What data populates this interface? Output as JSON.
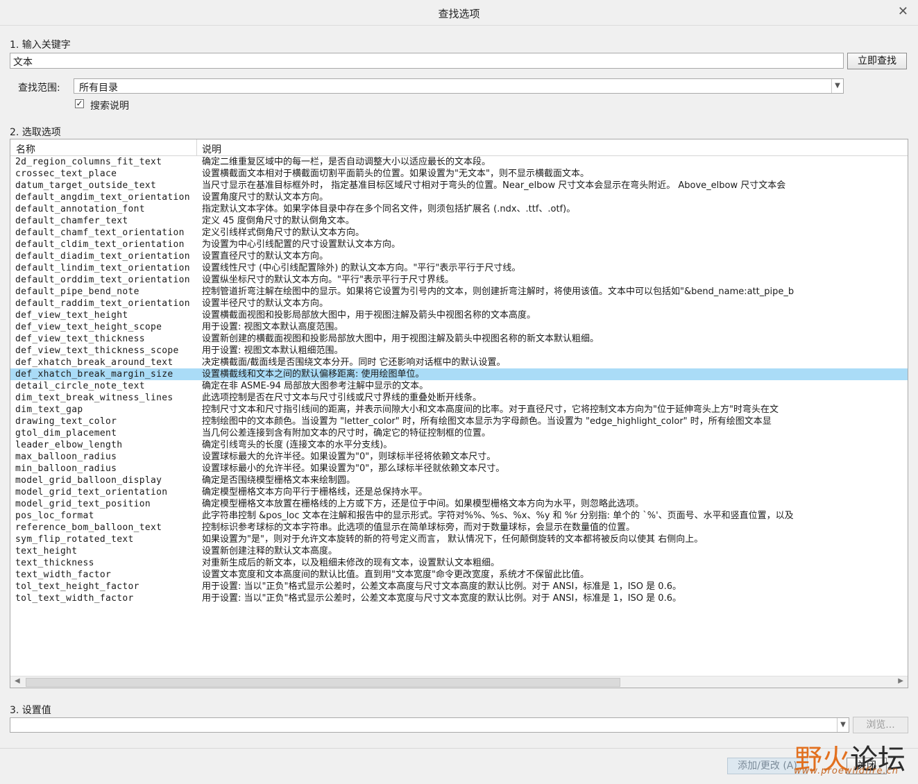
{
  "dialog": {
    "title": "查找选项"
  },
  "step1": {
    "label": "1.  输入关键字",
    "keyword_value": "文本",
    "search_button": "立即查找"
  },
  "scope": {
    "label": "查找范围:",
    "value": "所有目录"
  },
  "search_desc": {
    "label": "搜索说明",
    "checked": true
  },
  "step2": {
    "label": "2.  选取选项"
  },
  "table": {
    "columns": [
      "名称",
      "说明"
    ],
    "selected_index": 18,
    "rows": [
      {
        "name": "2d_region_columns_fit_text",
        "desc": "确定二维重复区域中的每一栏，是否自动调整大小以适应最长的文本段。"
      },
      {
        "name": "crossec_text_place",
        "desc": "设置横截面文本相对于横截面切割平面箭头的位置。如果设置为\"无文本\"，则不显示横截面文本。"
      },
      {
        "name": "datum_target_outside_text",
        "desc": "当尺寸显示在基准目标框外时， 指定基准目标区域尺寸相对于弯头的位置。Near_elbow 尺寸文本会显示在弯头附近。 Above_elbow 尺寸文本会"
      },
      {
        "name": "default_angdim_text_orientation",
        "desc": "设置角度尺寸的默认文本方向。"
      },
      {
        "name": "default_annotation_font",
        "desc": "指定默认文本字体。如果字体目录中存在多个同名文件，则须包括扩展名 (.ndx、.ttf、.otf)。"
      },
      {
        "name": "default_chamfer_text",
        "desc": "定义 45 度倒角尺寸的默认倒角文本。"
      },
      {
        "name": "default_chamf_text_orientation",
        "desc": "定义引线样式倒角尺寸的默认文本方向。"
      },
      {
        "name": "default_cldim_text_orientation",
        "desc": "为设置为中心引线配置的尺寸设置默认文本方向。"
      },
      {
        "name": "default_diadim_text_orientation",
        "desc": "设置直径尺寸的默认文本方向。"
      },
      {
        "name": "default_lindim_text_orientation",
        "desc": "设置线性尺寸 (中心引线配置除外) 的默认文本方向。\"平行\"表示平行于尺寸线。"
      },
      {
        "name": "default_orddim_text_orientation",
        "desc": "设置纵坐标尺寸的默认文本方向。\"平行\"表示平行于尺寸界线。"
      },
      {
        "name": "default_pipe_bend_note",
        "desc": "控制管道折弯注解在绘图中的显示。如果将它设置为引号内的文本，则创建折弯注解时，将使用该值。文本中可以包括如\"&bend_name:att_pipe_b"
      },
      {
        "name": "default_raddim_text_orientation",
        "desc": "设置半径尺寸的默认文本方向。"
      },
      {
        "name": "def_view_text_height",
        "desc": "设置横截面视图和投影局部放大图中，用于视图注解及箭头中视图名称的文本高度。"
      },
      {
        "name": "def_view_text_height_scope",
        "desc": "用于设置: 视图文本默认高度范围。"
      },
      {
        "name": "def_view_text_thickness",
        "desc": "设置新创建的横截面视图和投影局部放大图中，用于视图注解及箭头中视图名称的新文本默认粗细。"
      },
      {
        "name": "def_view_text_thickness_scope",
        "desc": "用于设置: 视图文本默认粗细范围。"
      },
      {
        "name": "def_xhatch_break_around_text",
        "desc": "决定横截面/截面线是否围绕文本分开。同时 它还影响对话框中的默认设置。"
      },
      {
        "name": "def_xhatch_break_margin_size",
        "desc": "设置横截线和文本之间的默认偏移距离: 使用绘图单位。"
      },
      {
        "name": "detail_circle_note_text",
        "desc": "确定在非 ASME-94 局部放大图参考注解中显示的文本。"
      },
      {
        "name": "dim_text_break_witness_lines",
        "desc": "此选项控制是否在尺寸文本与尺寸引线或尺寸界线的重叠处断开线条。"
      },
      {
        "name": "dim_text_gap",
        "desc": "控制尺寸文本和尺寸指引线间的距离，并表示间隙大小和文本高度间的比率。对于直径尺寸，它将控制文本方向为\"位于延伸弯头上方\"时弯头在文"
      },
      {
        "name": "drawing_text_color",
        "desc": "控制绘图中的文本颜色。当设置为 \"letter_color\" 时，所有绘图文本显示为字母颜色。当设置为 \"edge_highlight_color\" 时，所有绘图文本显"
      },
      {
        "name": "gtol_dim_placement",
        "desc": "当几何公差连接到含有附加文本的尺寸时，确定它的特征控制框的位置。"
      },
      {
        "name": "leader_elbow_length",
        "desc": "确定引线弯头的长度 (连接文本的水平分支线)。"
      },
      {
        "name": "max_balloon_radius",
        "desc": "设置球标最大的允许半径。如果设置为\"0\"，则球标半径将依赖文本尺寸。"
      },
      {
        "name": "min_balloon_radius",
        "desc": "设置球标最小的允许半径。如果设置为\"0\"，那么球标半径就依赖文本尺寸。"
      },
      {
        "name": "model_grid_balloon_display",
        "desc": "确定是否围绕模型栅格文本来绘制圆。"
      },
      {
        "name": "model_grid_text_orientation",
        "desc": "确定模型栅格文本方向平行于栅格线，还是总保持水平。"
      },
      {
        "name": "model_grid_text_position",
        "desc": "确定模型栅格文本放置在栅格线的上方或下方，还是位于中间。如果模型栅格文本方向为水平，则忽略此选项。"
      },
      {
        "name": "pos_loc_format",
        "desc": "此字符串控制 &pos_loc 文本在注解和报告中的显示形式。字符对%%、%s、%x、%y 和 %r 分别指: 单个的 `%'、页面号、水平和竖直位置，以及"
      },
      {
        "name": "reference_bom_balloon_text",
        "desc": "控制标识参考球标的文本字符串。此选项的值显示在简单球标旁，而对于数量球标，会显示在数量值的位置。"
      },
      {
        "name": "sym_flip_rotated_text",
        "desc": "如果设置为\"是\"，则对于允许文本旋转的新的符号定义而言， 默认情况下，任何颠倒旋转的文本都将被反向以使其 右侧向上。"
      },
      {
        "name": "text_height",
        "desc": "设置新创建注释的默认文本高度。"
      },
      {
        "name": "text_thickness",
        "desc": "对重新生成后的新文本，以及粗细未修改的现有文本，设置默认文本粗细。"
      },
      {
        "name": "text_width_factor",
        "desc": "设置文本宽度和文本高度间的默认比值。直到用\"文本宽度\"命令更改宽度，系统才不保留此比值。"
      },
      {
        "name": "tol_text_height_factor",
        "desc": "用于设置: 当以\"正负\"格式显示公差时，公差文本高度与尺寸文本高度的默认比例。对于 ANSI，标准是 1，ISO 是 0.6。"
      },
      {
        "name": "tol_text_width_factor",
        "desc": "用于设置: 当以\"正负\"格式显示公差时，公差文本宽度与尺寸文本宽度的默认比例。对于 ANSI，标准是 1，ISO 是 0.6。"
      }
    ]
  },
  "step3": {
    "label": "3.  设置值",
    "value": "",
    "browse_button": "浏览..."
  },
  "footer": {
    "add_button": "添加/更改 (A)",
    "close_button": "关闭"
  },
  "watermark": {
    "brand_part1": "野",
    "brand_part2": "火",
    "brand_part3": "论坛",
    "url": "www.proewildfire.cn"
  }
}
